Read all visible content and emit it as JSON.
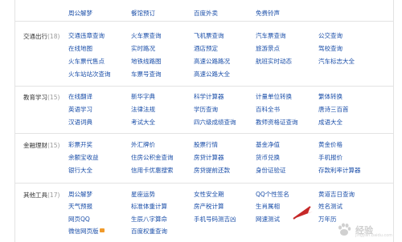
{
  "top_row": [
    "周公解梦",
    "餐馆预订",
    "百度外卖",
    "免费铃声"
  ],
  "sections": [
    {
      "name": "交通出行",
      "count": "(18)",
      "rows": [
        [
          "交通违章查询",
          "火车票查询",
          "飞机票查询",
          "汽车票查询",
          "公交查询"
        ],
        [
          "在线地图",
          "实时路况",
          "酒店预定",
          "旅游景点",
          "驾校查询"
        ],
        [
          "火车票代售点",
          "地铁线路图",
          "高速公路路况",
          "航班实时动态",
          "汽车标志大全"
        ],
        [
          "火车站站次查询",
          "车票号查询",
          "高速公路大全"
        ]
      ]
    },
    {
      "name": "教育学习",
      "count": "(15)",
      "rows": [
        [
          "在线翻译",
          "新华字典",
          "科学计算器",
          "计量单位转换",
          "繁体转换"
        ],
        [
          "英语学习",
          "法律法规",
          "学历查询",
          "百科全书",
          "唐诗三百首"
        ],
        [
          "汉语词典",
          "考试大全",
          "四六级成绩查询",
          "教师资格证查询",
          "成语大全"
        ]
      ]
    },
    {
      "name": "金融理财",
      "count": "(15)",
      "rows": [
        [
          "彩票开奖",
          "外汇牌价",
          "股票行情",
          "基金净值",
          "黄金价格"
        ],
        [
          "余额宝收益",
          "住房公积金查询",
          "房贷计算器",
          "货币兑换",
          "手机报价"
        ],
        [
          "银行大全",
          "信用卡优惠搜索",
          "房贷提前还款",
          "身份证验证",
          "存款利率计算器"
        ]
      ]
    },
    {
      "name": "其他工具",
      "count": "(17)",
      "rows": [
        [
          "周公解梦",
          "星座运势",
          "女性安全期",
          "QQ个性签名",
          "黄道吉日查询"
        ],
        [
          "天气预报",
          "标准体重计算",
          "房产税计算",
          "生肖属相",
          "姓名测试"
        ],
        [
          "网页QQ",
          "生辰八字算命",
          "手机号码测吉凶",
          "网速测试",
          "万年历"
        ],
        [
          "微信网页版",
          "百度权重查询"
        ]
      ]
    }
  ],
  "watermark": {
    "brand": "经验",
    "sub": "jingyan.baidu.com"
  },
  "colors": {
    "link": "#1a4ea8",
    "border": "#e3e3e3",
    "count": "#999999",
    "hot": "#f09a2b"
  },
  "icons": [
    "hot-badge-icon",
    "cursor-arrow-icon",
    "baidu-paw-icon"
  ]
}
